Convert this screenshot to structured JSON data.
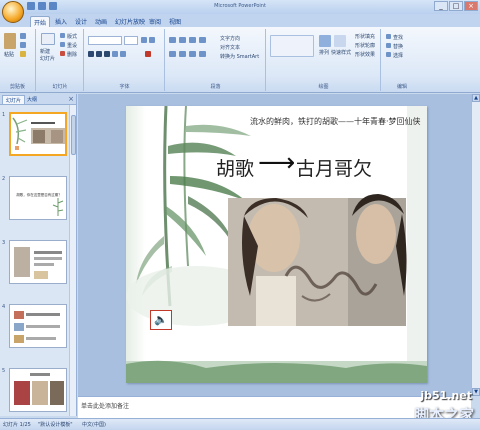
{
  "window": {
    "title": "Microsoft PowerPoint",
    "controls": [
      "_",
      "□",
      "×"
    ]
  },
  "tabs": [
    "开始",
    "插入",
    "设计",
    "动画",
    "幻灯片放映",
    "审阅",
    "视图"
  ],
  "ribbon": {
    "groups": [
      "剪贴板",
      "幻灯片",
      "字体",
      "段落",
      "绘图",
      "编辑"
    ],
    "paste_label": "粘贴",
    "new_slide_label": "新建\n幻灯片",
    "layout_label": "版式",
    "reset_label": "重设",
    "delete_label": "删除",
    "text_direction_label": "文字方向",
    "align_text_label": "对齐文本",
    "smartart_label": "转换为 SmartArt",
    "arrange_label": "排列",
    "quick_styles_label": "快速样式",
    "shape_fill_label": "形状填充",
    "shape_outline_label": "形状轮廓",
    "shape_effects_label": "形状效果",
    "find_label": "查找",
    "replace_label": "替换",
    "select_label": "选择"
  },
  "panel": {
    "tab_slides": "幻灯片",
    "tab_outline": "大纲",
    "slide_numbers": [
      "1",
      "2",
      "3",
      "4",
      "5"
    ],
    "thumb2_text": "胡歌，你在这里是否有过期？"
  },
  "slide": {
    "tagline": "流水的鲜肉，铁打的胡歌——十年青春·梦回仙侠",
    "title_a": "胡歌",
    "arrow": "⟶",
    "title_b": "古月哥欠",
    "sound_icon": "🔈"
  },
  "notes": {
    "placeholder": "单击此处添加备注"
  },
  "statusbar": {
    "slide_count": "幻灯片 1/25",
    "theme": "\"默认设计模板\"",
    "language": "中文(中国)"
  },
  "watermark": {
    "domain": "jb51.net",
    "brand": "脚本之家"
  },
  "colors": {
    "accent": "#f5a623",
    "ribbon_bg": "#dce8f7",
    "selected_border": "#f5a623"
  }
}
